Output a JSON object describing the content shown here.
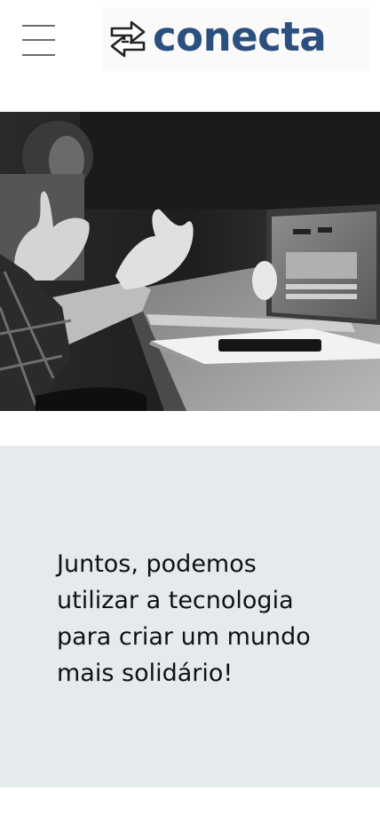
{
  "header": {
    "menu_icon": "hamburger-menu-icon",
    "logo": {
      "icon": "swap-arrows-icon",
      "text": "conecta",
      "color": "#2b4f7e"
    }
  },
  "hero": {
    "image": "grayscale photo of meeting table with laptop, notebook and phone"
  },
  "band": {
    "background": "#e5eaed",
    "tagline": "Juntos, podemos utilizar a tecnologia para criar um mundo mais solidário!"
  }
}
